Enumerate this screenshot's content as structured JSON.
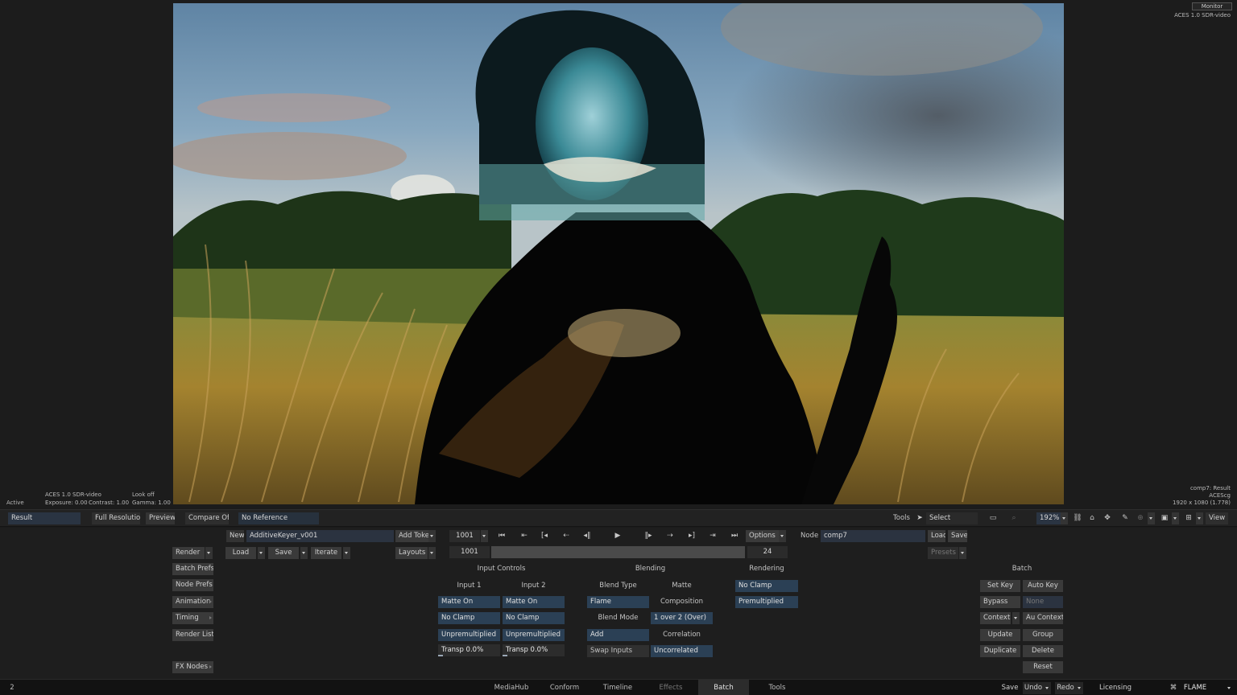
{
  "viewer": {
    "monitor_label": "Monitor",
    "color_space_top": "ACES 1.0 SDR-video",
    "bottom_left": {
      "status": "Active",
      "colorspace": "ACES 1.0 SDR-video",
      "exposure": "Exposure: 0.00",
      "contrast": "Contrast: 1.00",
      "look": "Look off",
      "gamma": "Gamma: 1.00"
    },
    "bottom_right": {
      "node_result": "comp7: Result",
      "working_space": "ACEScg",
      "resolution": "1920 x 1080 (1.778)"
    }
  },
  "viewbar": {
    "result_field": "Result",
    "full_resolution": "Full Resolution",
    "preview": "Preview",
    "compare": "Compare Off",
    "reference": "No Reference",
    "tools_label": "Tools",
    "select_label": "Select",
    "zoom": "192%",
    "view_label": "View"
  },
  "batch": {
    "new_label": "New",
    "batch_name": "AdditiveKeyer_v001",
    "add_token": "Add Token",
    "load": "Load",
    "save": "Save",
    "iterate": "Iterate",
    "layouts": "Layouts",
    "render": "Render",
    "left_menu": [
      "Batch Prefs",
      "Node Prefs",
      "Animation",
      "Timing",
      "Render List"
    ],
    "fx_nodes": "FX Nodes"
  },
  "transport": {
    "frame": "1001",
    "timeline_frame": "1001",
    "fps": "24",
    "options": "Options"
  },
  "node": {
    "node_label": "Node",
    "node_name": "comp7",
    "load": "Load",
    "save": "Save",
    "presets": "Presets"
  },
  "input_controls": {
    "title": "Input Controls",
    "input1": "Input 1",
    "input2": "Input 2",
    "in1": [
      "Matte On",
      "No Clamp",
      "Unpremultiplied",
      "Transp 0.0%"
    ],
    "in2": [
      "Matte On",
      "No Clamp",
      "Unpremultiplied",
      "Transp 0.0%"
    ]
  },
  "blending": {
    "title": "Blending",
    "blend_type_label": "Blend Type",
    "matte_label": "Matte",
    "blend_type": "Flame",
    "matte": "Composition",
    "blend_mode_label": "Blend Mode",
    "matte_mode": "1 over 2 (Over)",
    "blend_mode": "Add",
    "correlation_label": "Correlation",
    "swap_inputs": "Swap Inputs",
    "correlation": "Uncorrelated"
  },
  "rendering": {
    "title": "Rendering",
    "clamp": "No Clamp",
    "premult": "Premultiplied"
  },
  "batch_keys": {
    "title": "Batch",
    "set_key": "Set Key",
    "auto_key": "Auto Key",
    "bypass": "Bypass",
    "none": "None",
    "context": "Context",
    "au_context": "Au Context",
    "update": "Update",
    "group": "Group",
    "duplicate": "Duplicate",
    "delete": "Delete",
    "reset": "Reset"
  },
  "tabs": {
    "left_number": "2",
    "items": [
      "MediaHub",
      "Conform",
      "Timeline",
      "Effects",
      "Batch",
      "Tools"
    ],
    "active": "Batch",
    "save": "Save",
    "undo": "Undo",
    "redo": "Redo",
    "licensing": "Licensing",
    "brand": "FLAME"
  },
  "colors": {
    "accent_field": "#2b4055",
    "panel_bg": "#1e1e1e",
    "tabbar_bg": "#121212"
  }
}
